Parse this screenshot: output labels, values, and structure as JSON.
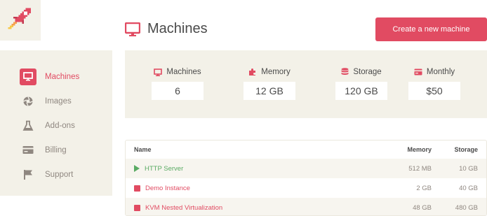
{
  "header": {
    "title": "Machines",
    "create_button": "Create a new machine"
  },
  "colors": {
    "accent": "#e14b62",
    "panel": "#f3f1e8",
    "running": "#5aab64"
  },
  "sidebar": {
    "items": [
      {
        "label": "Machines",
        "icon": "monitor-icon",
        "active": true
      },
      {
        "label": "Images",
        "icon": "aperture-icon",
        "active": false
      },
      {
        "label": "Add-ons",
        "icon": "flask-icon",
        "active": false
      },
      {
        "label": "Billing",
        "icon": "credit-card-icon",
        "active": false
      },
      {
        "label": "Support",
        "icon": "flag-icon",
        "active": false
      }
    ]
  },
  "stats": [
    {
      "label": "Machines",
      "value": "6",
      "icon": "monitor-icon"
    },
    {
      "label": "Memory",
      "value": "12 GB",
      "icon": "puzzle-icon"
    },
    {
      "label": "Storage",
      "value": "120 GB",
      "icon": "database-icon"
    },
    {
      "label": "Monthly",
      "value": "$50",
      "icon": "credit-card-icon"
    }
  ],
  "table": {
    "columns": {
      "name": "Name",
      "memory": "Memory",
      "storage": "Storage"
    },
    "rows": [
      {
        "name": "HTTP Server",
        "memory": "512 MB",
        "storage": "10 GB",
        "status": "running"
      },
      {
        "name": "Demo Instance",
        "memory": "2 GB",
        "storage": "40 GB",
        "status": "stopped"
      },
      {
        "name": "KVM Nested Virtualization",
        "memory": "48 GB",
        "storage": "480 GB",
        "status": "stopped"
      }
    ]
  }
}
